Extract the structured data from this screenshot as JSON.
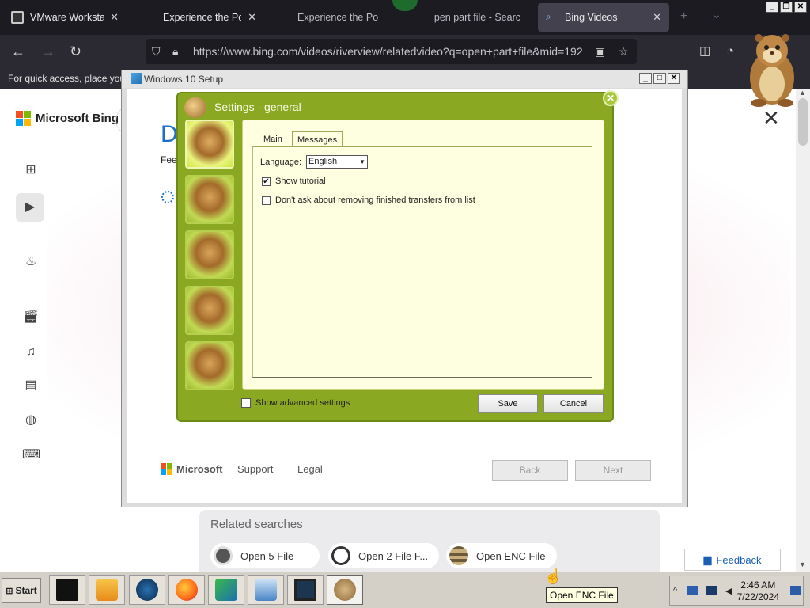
{
  "browser": {
    "tabs": [
      {
        "title": "VMware Workstation",
        "icon": "vmware-icon",
        "active": false
      },
      {
        "title": "Experience the Powe",
        "icon": "microsoft-logo-icon",
        "active": false
      },
      {
        "title": "Experience the Po",
        "title_tail": "pen part file - Searc",
        "icon": "microsoft-logo-icon",
        "active": false
      },
      {
        "title": "Bing Videos",
        "icon": "search-icon",
        "active": true
      }
    ],
    "close_tab": "✕",
    "url": "https://www.bing.com/videos/riverview/relatedvideo?q=open+part+file&mid=192",
    "bookmark_hint": "For quick access, place you"
  },
  "bing": {
    "logo_text": "Microsoft Bing",
    "related": {
      "title": "Related searches",
      "chips": [
        "Open 5 File",
        "Open 2 File F...",
        "Open ENC File"
      ]
    },
    "feedback": "Feedback"
  },
  "setup": {
    "title": "Windows 10 Setup",
    "heading": "D",
    "subtext": "Feel",
    "footer": {
      "brand": "Microsoft",
      "support": "Support",
      "legal": "Legal",
      "back": "Back",
      "next": "Next"
    }
  },
  "settings": {
    "title": "Settings - general",
    "tabs": [
      "Main",
      "Messages"
    ],
    "language_label": "Language:",
    "language_value": "English",
    "show_tutorial": "Show tutorial",
    "show_tutorial_checked": true,
    "dont_ask": "Don't ask about removing finished transfers from list",
    "dont_ask_checked": false,
    "show_advanced": "Show advanced settings",
    "show_advanced_checked": false,
    "save": "Save",
    "cancel": "Cancel"
  },
  "taskbar": {
    "start": "Start",
    "time": "2:46 AM",
    "date": "7/22/2024",
    "tooltip": "Open ENC File"
  },
  "colors": {
    "settings_green": "#8aa822",
    "panel_cream": "#fefee0",
    "browser_dark": "#1c1b22",
    "bing_blue": "#1f6fc9"
  }
}
